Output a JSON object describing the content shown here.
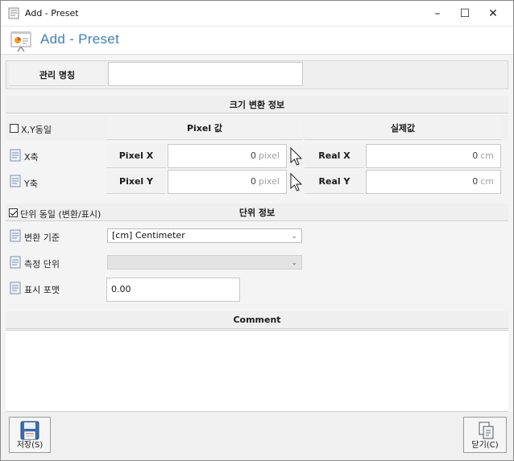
{
  "window": {
    "title": "Add - Preset",
    "min_glyph": "–",
    "max_glyph": "☐",
    "close_glyph": "✕"
  },
  "header": {
    "heading": "Add - Preset"
  },
  "management": {
    "label": "관리 명칭",
    "value": ""
  },
  "size_section": {
    "title": "크기 변환 정보",
    "xy_same_label": "X,Y동일",
    "xy_same_checked": false,
    "pixel_header": "Pixel 값",
    "real_header": "실제값",
    "rows": [
      {
        "axis_label": "X축",
        "pixel_label": "Pixel X",
        "pixel_value": "0",
        "pixel_unit": "pixel",
        "real_label": "Real X",
        "real_value": "0",
        "real_unit": "cm"
      },
      {
        "axis_label": "Y축",
        "pixel_label": "Pixel Y",
        "pixel_value": "0",
        "pixel_unit": "pixel",
        "real_label": "Real Y",
        "real_value": "0",
        "real_unit": "cm"
      }
    ]
  },
  "unit_section": {
    "title": "단위 정보",
    "unit_same_label": "단위 동일 (변환/표시)",
    "unit_same_checked": true,
    "conversion_label": "변환 기준",
    "conversion_value": "[cm] Centimeter",
    "measure_label": "측정 단위",
    "measure_value": "",
    "format_label": "표시 포맷",
    "format_value": "0.00"
  },
  "comment": {
    "title": "Comment",
    "value": ""
  },
  "footer": {
    "save_label": "저장(S)",
    "close_label": "닫기(C)"
  },
  "colors": {
    "heading": "#3f7fb8",
    "band": "#efefef",
    "panel": "#f2f2f2"
  }
}
